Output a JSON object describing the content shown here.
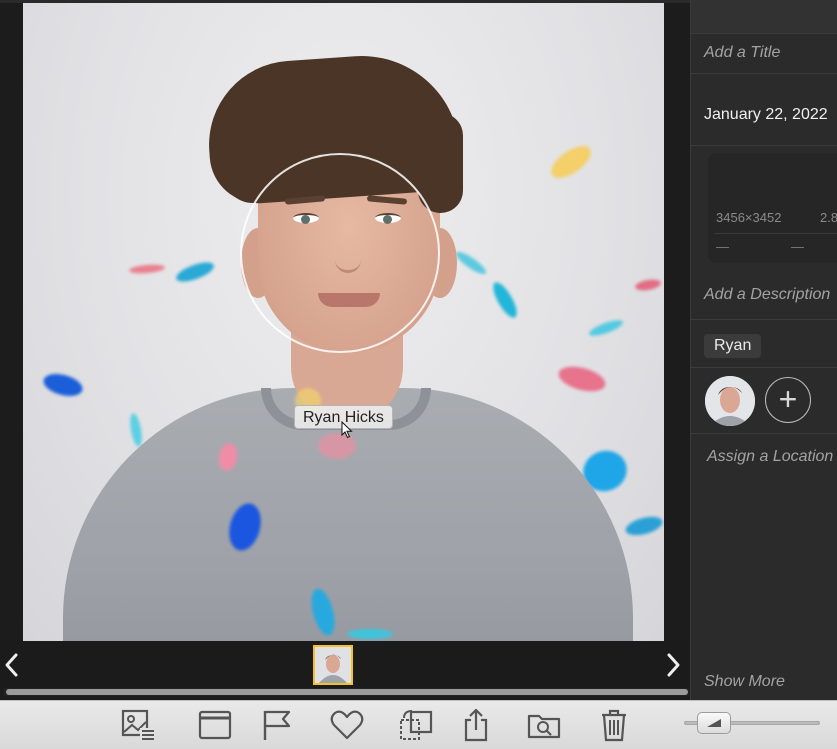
{
  "viewer": {
    "face_tag": "Ryan Hicks",
    "prev_icon": "chevron-left-icon",
    "next_icon": "chevron-right-icon"
  },
  "info": {
    "title_placeholder": "Add a Title",
    "date": "January 22, 2022",
    "resolution": "3456×3452",
    "file_size": "2.8",
    "meta_dash_1": "—",
    "meta_dash_2": "—",
    "meta_dash_3": "—",
    "description_placeholder": "Add a Description",
    "person_chip": "Ryan",
    "add_face_label": "+",
    "location_placeholder": "Assign a Location",
    "show_more": "Show More"
  },
  "toolbar": {
    "buttons": [
      "adjust-icon",
      "window-icon",
      "flag-icon",
      "heart-icon",
      "crop-rotate-icon",
      "share-icon",
      "folder-search-icon",
      "trash-icon"
    ],
    "zoom_icon": "mountain-icon"
  },
  "colors": {
    "accent_selection": "#f2c12e",
    "panel_bg": "#2b2b2b",
    "toolbar_bg": "#e2e2e2"
  }
}
